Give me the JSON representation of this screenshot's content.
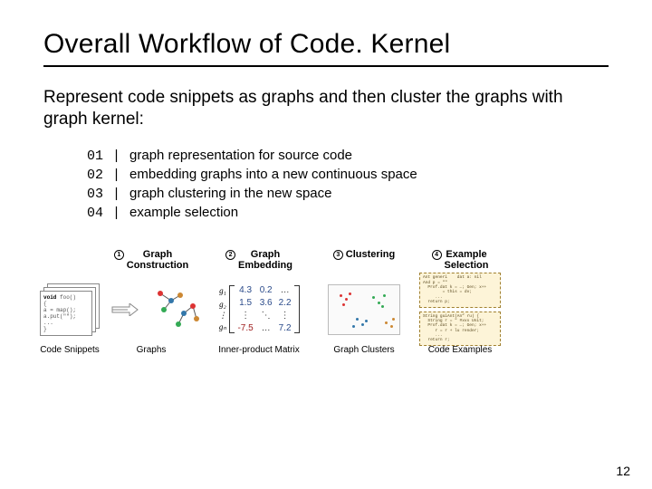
{
  "title": "Overall Workflow of Code. Kernel",
  "subtitle": "Represent code snippets as graphs and then cluster the graphs with graph kernel:",
  "steps": [
    {
      "num": "01",
      "text": "graph representation for source code"
    },
    {
      "num": "02",
      "text": "embedding graphs into a new continuous space"
    },
    {
      "num": "03",
      "text": "graph clustering in the new space"
    },
    {
      "num": "04",
      "text": "example selection"
    }
  ],
  "stages": {
    "s1": {
      "num": "1",
      "label": "Graph\nConstruction"
    },
    "s2": {
      "num": "2",
      "label": "Graph\nEmbedding"
    },
    "s3": {
      "num": "3",
      "label": "Clustering"
    },
    "s4": {
      "num": "4",
      "label": "Example\nSelection"
    }
  },
  "bottom_labels": {
    "snippets": "Code Snippets",
    "graphs": "Graphs",
    "matrix": "Inner-product Matrix",
    "clusters": "Graph Clusters",
    "examples": "Code Examples"
  },
  "code_card": {
    "l1_kw": "void",
    "l1_rest": " foo()",
    "l2": "{",
    "l3": "  a = map();",
    "l4": "  a.put(\"\");",
    "l5": "  ...",
    "l6": "}"
  },
  "matrix": {
    "g_labels": [
      "g₁",
      "g₂",
      "gₙ"
    ],
    "rows": [
      [
        "4.3",
        "0.2",
        ""
      ],
      [
        "1.5",
        "3.6",
        "2.2"
      ],
      [
        "-7.5",
        "",
        "7.2"
      ]
    ]
  },
  "example_cards": {
    "c1": "Ant generi    dat a: nil\nAnd p = \"\"\n  Prof.dat k = …; Gen; x++\n        = this = dv;\n     ...\n  return p;",
    "c2": "String guiAnt(An” ru) {\n  String r = \" #xvx Unit;\n  Prof.dat k = …; Gen; x++\n     r = r + lu render;\n     ...\n  return r;"
  },
  "page_number": "12"
}
